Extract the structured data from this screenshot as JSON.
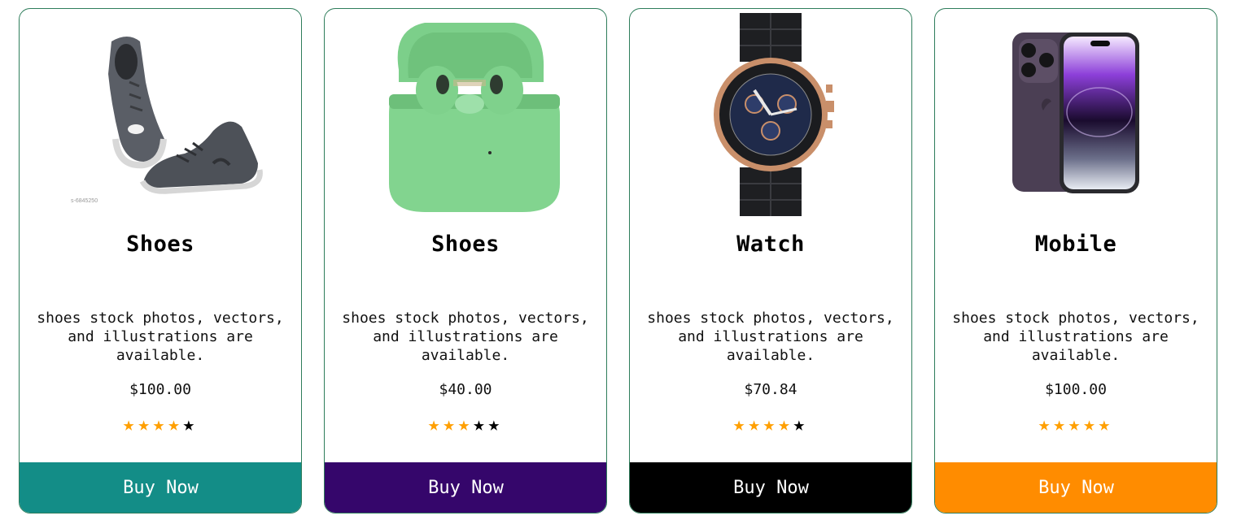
{
  "products": [
    {
      "image_icon": "sneakers-image",
      "title": "Shoes",
      "description": "shoes stock photos, vectors, and illustrations are available.",
      "price": "$100.00",
      "rating": 4,
      "max_rating": 5,
      "button_label": "Buy Now",
      "button_color": "#138d87"
    },
    {
      "image_icon": "earbuds-image",
      "title": "Shoes",
      "description": "shoes stock photos, vectors, and illustrations are available.",
      "price": "$40.00",
      "rating": 3,
      "max_rating": 5,
      "button_label": "Buy Now",
      "button_color": "#35066b"
    },
    {
      "image_icon": "wristwatch-image",
      "title": "Watch",
      "description": "shoes stock photos, vectors, and illustrations are available.",
      "price": "$70.84",
      "rating": 4,
      "max_rating": 5,
      "button_label": "Buy Now",
      "button_color": "#000000"
    },
    {
      "image_icon": "smartphone-image",
      "title": "Mobile",
      "description": "shoes stock photos, vectors, and illustrations are available.",
      "price": "$100.00",
      "rating": 5,
      "max_rating": 5,
      "button_label": "Buy Now",
      "button_color": "#ff8c00"
    }
  ]
}
